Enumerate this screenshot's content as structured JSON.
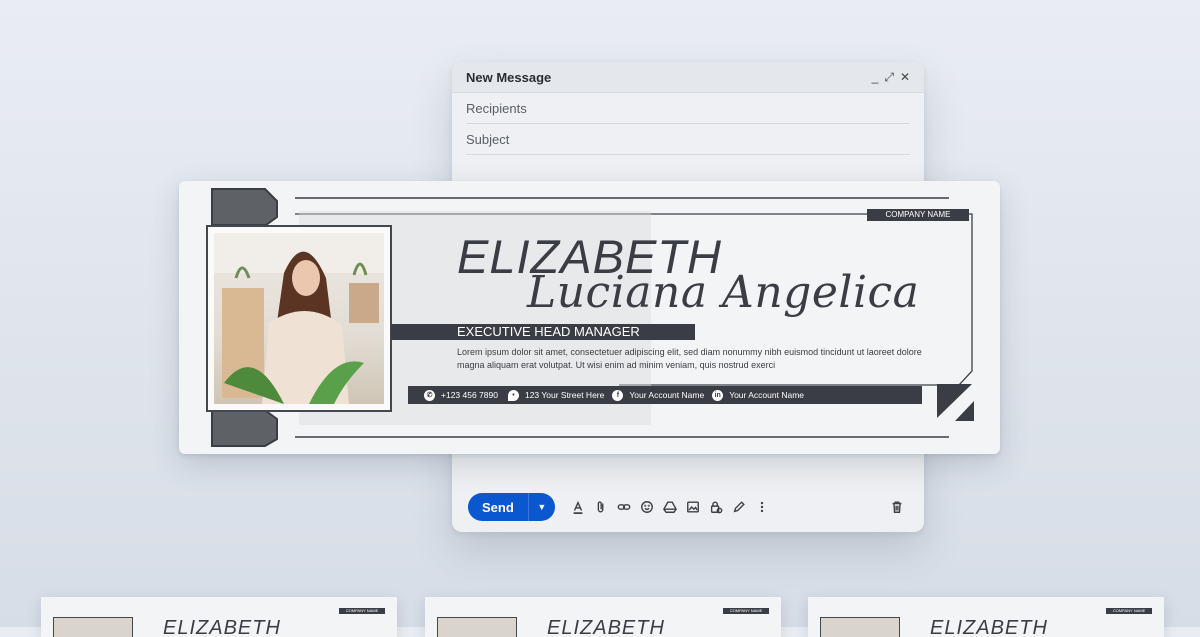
{
  "compose": {
    "title": "New Message",
    "minimize_glyph": "_",
    "expand_glyph": "⤢",
    "close_glyph": "✕",
    "recipients_placeholder": "Recipients",
    "subject_placeholder": "Subject",
    "send_label": "Send",
    "toolbar_icons": [
      "format-text-icon",
      "attach-icon",
      "link-icon",
      "emoji-icon",
      "drive-icon",
      "image-icon",
      "lock-icon",
      "pen-icon",
      "more-icon"
    ],
    "trash_icon": "trash-icon"
  },
  "signature": {
    "company": "COMPANY NAME",
    "first_name": "ELIZABETH",
    "last_name": "Luciana Angelica",
    "job_title": "EXECUTIVE HEAD MANAGER",
    "bio": "Lorem ipsum dolor sit amet, consectetuer adipiscing elit, sed diam nonummy nibh euismod tincidunt ut laoreet dolore magna aliquam erat volutpat. Ut wisi enim ad minim veniam, quis nostrud exerci",
    "phone": "+123 456 7890",
    "address": "123 Your Street Here",
    "facebook": "Your Account Name",
    "linkedin": "Your Account Name"
  },
  "thumbnails": [
    {
      "name": "ELIZABETH",
      "company": "COMPANY NAME"
    },
    {
      "name": "ELIZABETH",
      "company": "COMPANY NAME"
    },
    {
      "name": "ELIZABETH",
      "company": "COMPANY NAME"
    }
  ],
  "colors": {
    "accent_send": "#0b57d0",
    "dark": "#3a3d43",
    "card_bg": "#f3f4f6"
  }
}
